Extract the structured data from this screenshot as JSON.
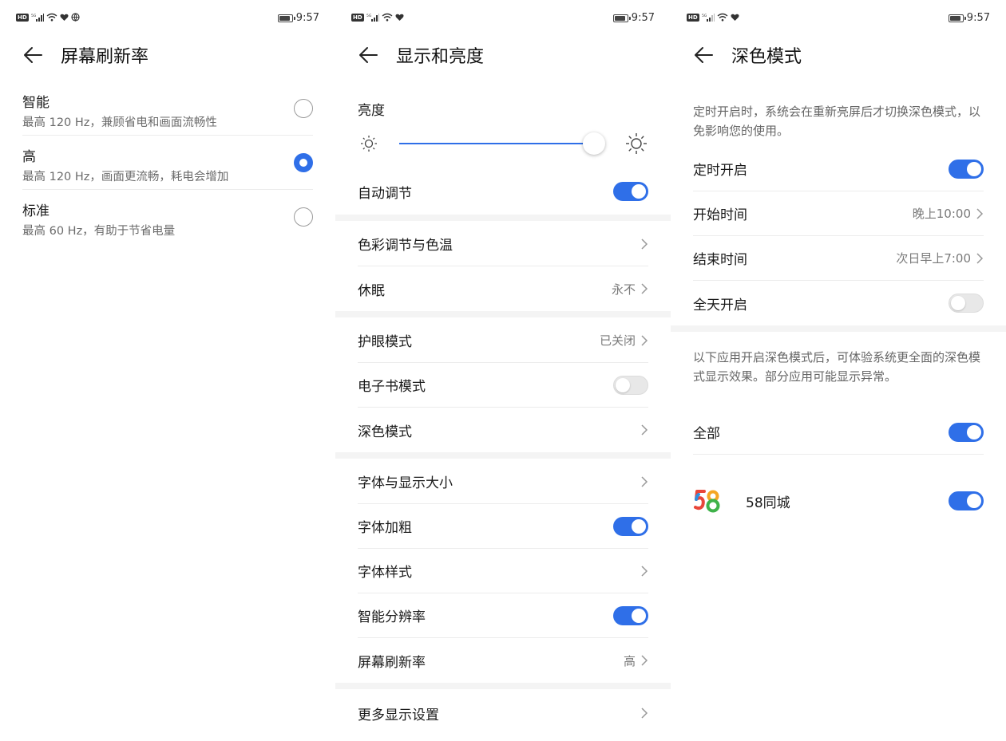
{
  "status_bar": {
    "time": "9:57"
  },
  "screen1": {
    "title": "屏幕刷新率",
    "options": [
      {
        "title": "智能",
        "subtitle": "最高 120 Hz，兼顾省电和画面流畅性",
        "selected": false
      },
      {
        "title": "高",
        "subtitle": "最高 120 Hz，画面更流畅，耗电会增加",
        "selected": true
      },
      {
        "title": "标准",
        "subtitle": "最高 60 Hz，有助于节省电量",
        "selected": false
      }
    ]
  },
  "screen2": {
    "title": "显示和亮度",
    "brightness_label": "亮度",
    "brightness_level": 1.0,
    "auto_adjust": "自动调节",
    "items": {
      "color": "色彩调节与色温",
      "sleep": "休眠",
      "sleep_value": "永不",
      "eye": "护眼模式",
      "eye_value": "已关闭",
      "ebook": "电子书模式",
      "dark": "深色模式",
      "font_size": "字体与显示大小",
      "bold": "字体加粗",
      "font_style": "字体样式",
      "smart_res": "智能分辨率",
      "refresh": "屏幕刷新率",
      "refresh_value": "高",
      "more": "更多显示设置"
    }
  },
  "screen3": {
    "title": "深色模式",
    "desc1": "定时开启时，系统会在重新亮屏后才切换深色模式，以免影响您的使用。",
    "scheduled": "定时开启",
    "start": "开始时间",
    "start_value": "晚上10:00",
    "end": "结束时间",
    "end_value": "次日早上7:00",
    "all_day": "全天开启",
    "desc2": "以下应用开启深色模式后，可体验系统更全面的深色模式显示效果。部分应用可能显示异常。",
    "all_apps": "全部",
    "app_name": "58同城",
    "app_logo_text": "58"
  },
  "colors": {
    "accent": "#2f6fe8"
  }
}
